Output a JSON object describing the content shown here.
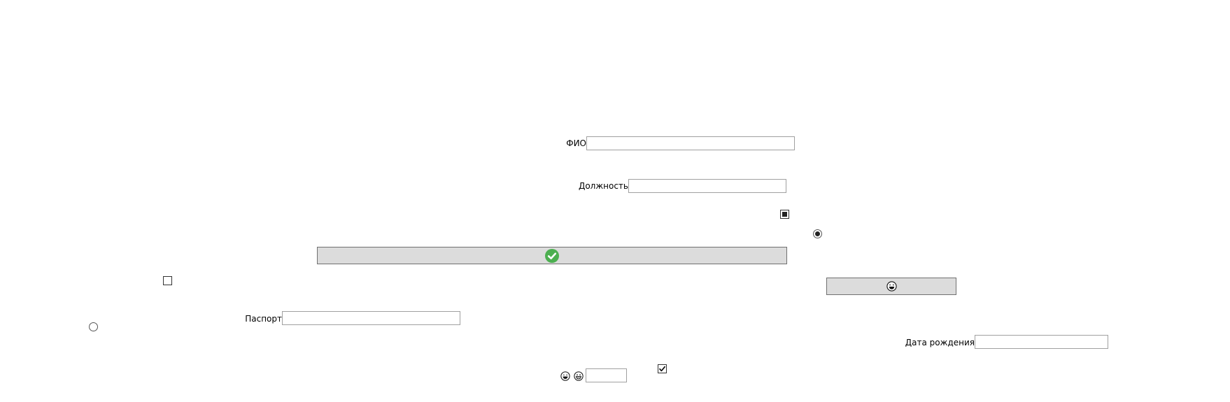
{
  "form": {
    "fio_label": "ФИО",
    "fio_value": "",
    "position_label": "Должность",
    "position_value": "",
    "passport_label": "Паспорт",
    "passport_value": "",
    "birthdate_label": "Дата рождения",
    "birthdate_value": "",
    "small_field_value": ""
  },
  "controls": {
    "checkbox_top": "indeterminate",
    "radio_top": "selected",
    "checkbox_left": "unchecked",
    "radio_left": "unselected",
    "checkbox_bottom": "checked"
  },
  "icons": {
    "confirm_button_icon": "check-circle-icon",
    "confirm_button_icon_color": "#4caf50",
    "emoji_button_icon": "laughing-face-icon",
    "emoji_bottom_1": "laughing-face-icon",
    "emoji_bottom_2": "grinning-face-icon"
  },
  "colors": {
    "button_bg": "#dcdcdc",
    "textbox_border": "#a0a0a0"
  }
}
